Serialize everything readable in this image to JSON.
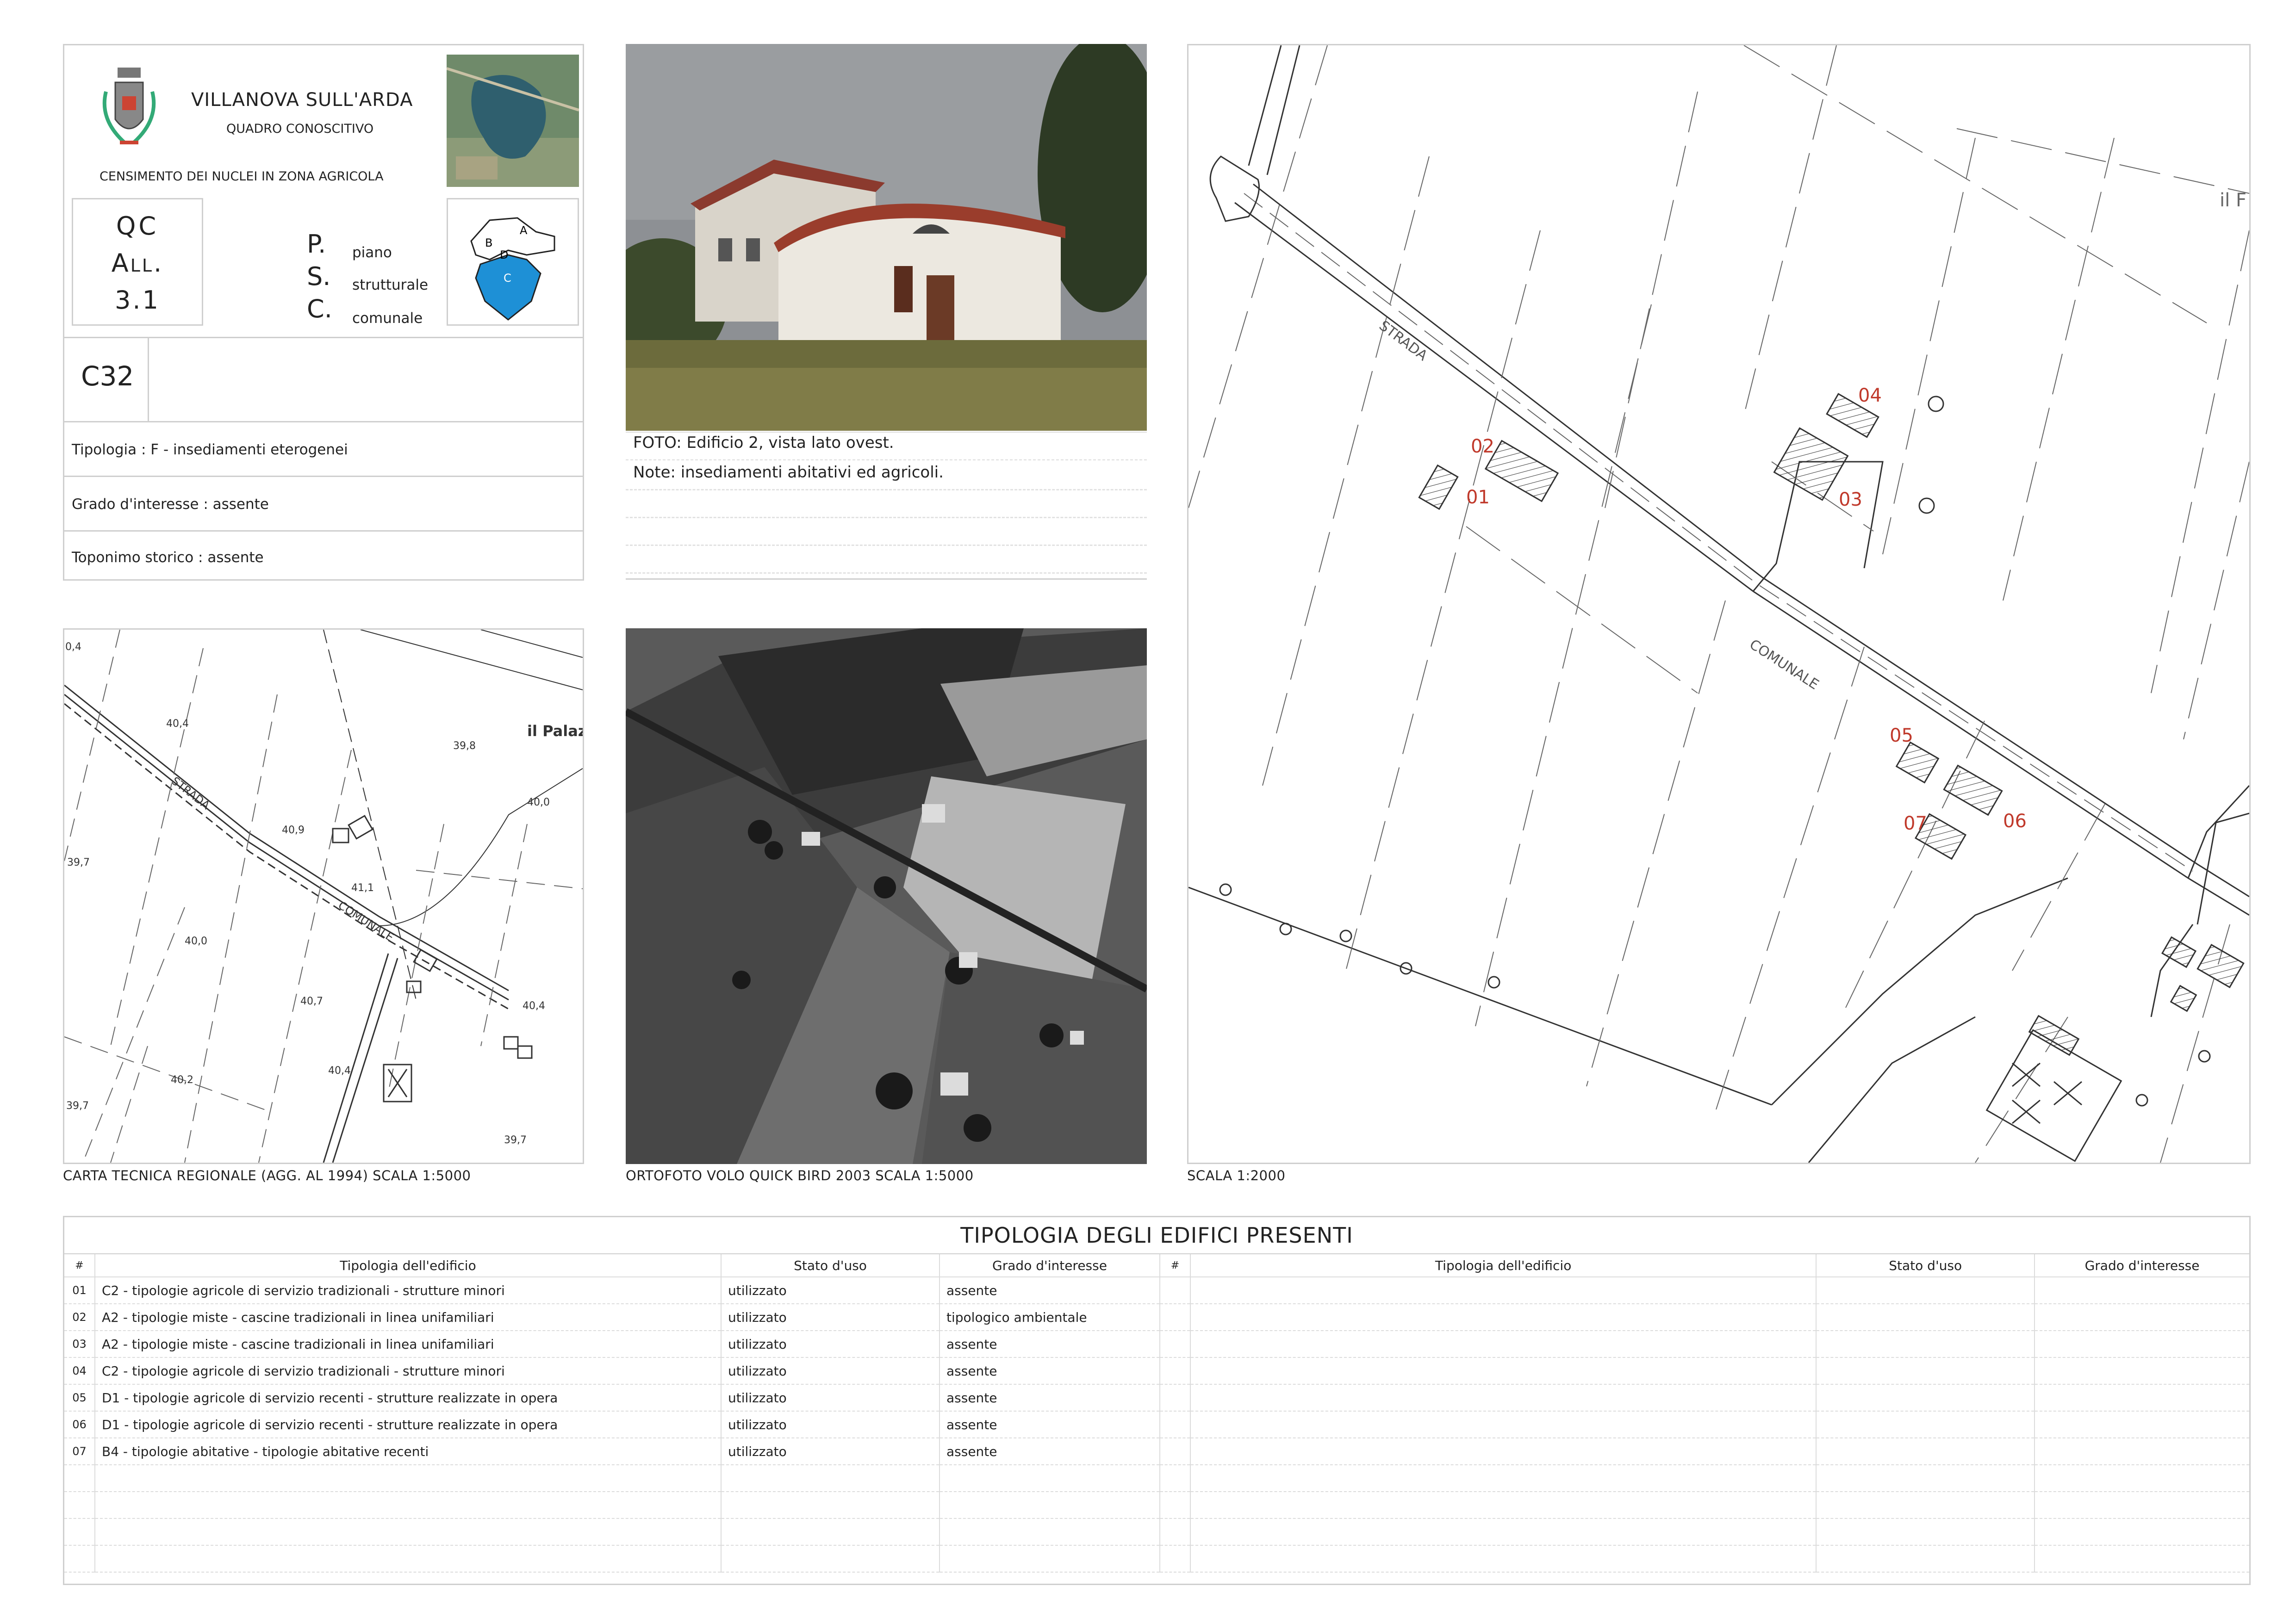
{
  "header": {
    "municipality": "VILLANOVA SULL'ARDA",
    "subtitle": "QUADRO CONOSCITIVO",
    "census_title": "CENSIMENTO DEI NUCLEI IN ZONA AGRICOLA",
    "qc_line1": "QC",
    "qc_line2": "All.",
    "qc_line3": "3.1",
    "psc_p": "P.",
    "psc_s": "S.",
    "psc_c": "C.",
    "psc_piano": "piano",
    "psc_strutturale": "strutturale",
    "psc_comunale": "comunale",
    "zone_a": "A",
    "zone_b": "B",
    "zone_c": "C",
    "zone_d": "D"
  },
  "scheda": {
    "code": "C32",
    "tipologia": "Tipologia : F  - insediamenti eterogenei",
    "grado": "Grado d'interesse : assente",
    "toponimo": "Toponimo storico : assente"
  },
  "photo": {
    "caption": "FOTO: Edificio 2, vista lato ovest.",
    "note": "Note: insediamenti abitativi ed agricoli."
  },
  "maps": {
    "ctr_caption": "CARTA TECNICA REGIONALE (AGG. AL 1994) SCALA 1:5000",
    "ortho_caption": "ORTOFOTO VOLO QUICK BIRD 2003 SCALA 1:5000",
    "plan_caption": "SCALA 1:2000",
    "ctr_labels": {
      "strada": "STRADA",
      "comunale": "COMUNALE",
      "palazzo": "il Palaz",
      "h404a": "40,4",
      "h409": "40,9",
      "h398": "39,8",
      "h400a": "40,0",
      "h397a": "39,7",
      "h411": "41,1",
      "h400b": "40,0",
      "h407": "40,7",
      "h404b": "40,4",
      "h404c": "40,4",
      "h402": "40,2",
      "h397b": "39,7",
      "h397c": "39,7",
      "h404d": "0,4"
    },
    "plan_labels": {
      "strada": "STRADA",
      "comunale": "COMUNALE",
      "il": "il F",
      "b01": "01",
      "b02": "02",
      "b03": "03",
      "b04": "04",
      "b05": "05",
      "b06": "06",
      "b07": "07"
    }
  },
  "table": {
    "title": "TIPOLOGIA DEGLI EDIFICI PRESENTI",
    "headers": {
      "num": "#",
      "tipologia": "Tipologia dell'edificio",
      "stato": "Stato d'uso",
      "grado": "Grado d'interesse"
    },
    "rows": [
      {
        "num": "01",
        "tipologia": "C2 - tipologie agricole di servizio tradizionali - strutture minori",
        "stato": "utilizzato",
        "grado": "assente"
      },
      {
        "num": "02",
        "tipologia": "A2 - tipologie miste - cascine tradizionali in linea unifamiliari",
        "stato": "utilizzato",
        "grado": "tipologico ambientale"
      },
      {
        "num": "03",
        "tipologia": "A2 - tipologie miste - cascine tradizionali in linea unifamiliari",
        "stato": "utilizzato",
        "grado": "assente"
      },
      {
        "num": "04",
        "tipologia": "C2 - tipologie agricole di servizio tradizionali - strutture minori",
        "stato": "utilizzato",
        "grado": "assente"
      },
      {
        "num": "05",
        "tipologia": "D1 - tipologie agricole di servizio recenti - strutture realizzate in opera",
        "stato": "utilizzato",
        "grado": "assente"
      },
      {
        "num": "06",
        "tipologia": "D1 - tipologie agricole di servizio recenti - strutture realizzate in opera",
        "stato": "utilizzato",
        "grado": "assente"
      },
      {
        "num": "07",
        "tipologia": "B4 - tipologie abitative - tipologie abitative recenti",
        "stato": "utilizzato",
        "grado": "assente"
      }
    ]
  },
  "colors": {
    "accent_blue": "#1e90d6",
    "label_red": "#c0392b",
    "border": "#cfcfcf"
  }
}
